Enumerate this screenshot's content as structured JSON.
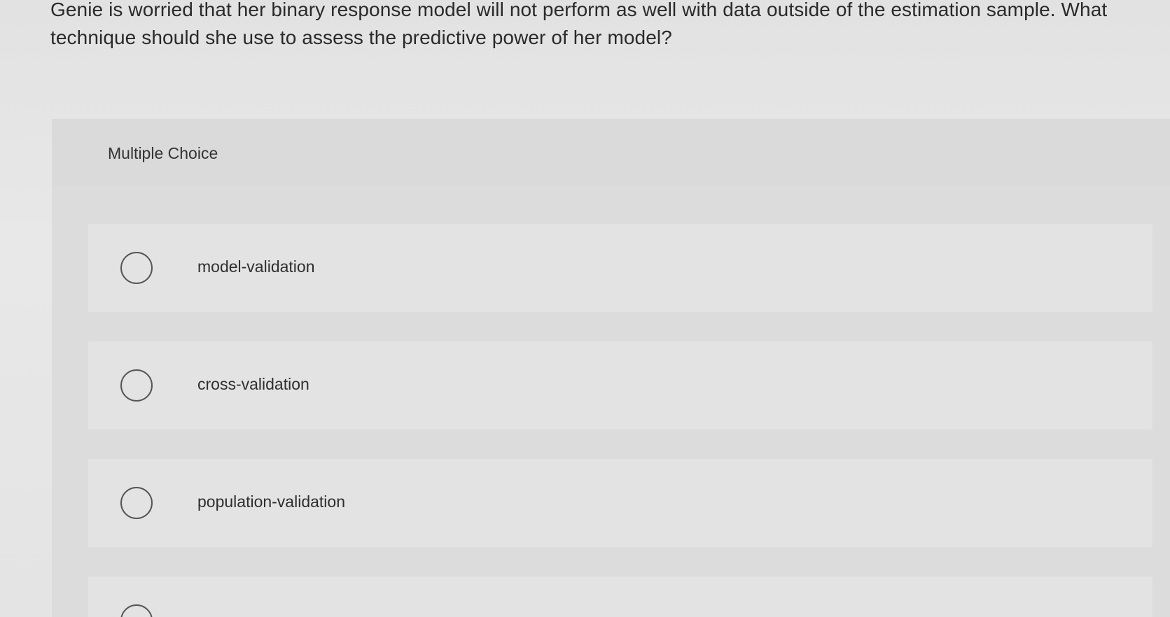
{
  "question": {
    "line1": "Genie is worried that her binary response model will not perform as well with data outside of the estimation sample. What",
    "line2": "technique should she use to assess the predictive power of her model?"
  },
  "multiple_choice": {
    "title": "Multiple Choice",
    "options": [
      {
        "label": "model-validation",
        "selected": false
      },
      {
        "label": "cross-validation",
        "selected": false
      },
      {
        "label": "population-validation",
        "selected": false
      },
      {
        "label": "",
        "selected": false
      }
    ]
  }
}
